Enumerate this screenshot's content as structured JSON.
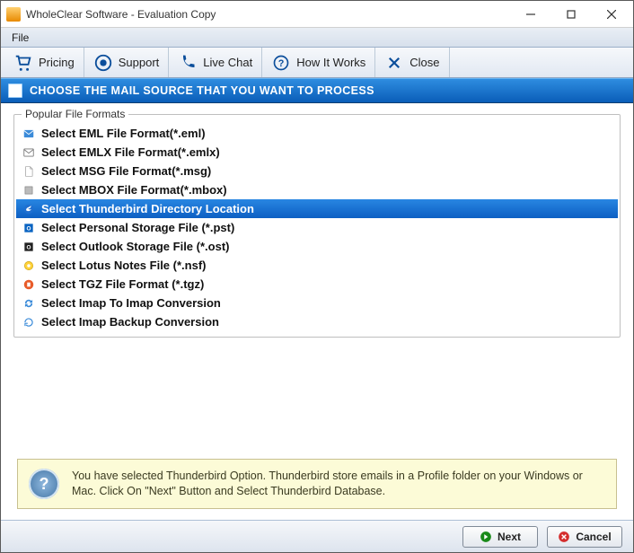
{
  "window": {
    "title": "WholeClear Software - Evaluation Copy"
  },
  "menubar": {
    "file": "File"
  },
  "toolbar": {
    "pricing": "Pricing",
    "support": "Support",
    "livechat": "Live Chat",
    "howitworks": "How It Works",
    "close": "Close"
  },
  "header": {
    "text": "CHOOSE THE MAIL SOURCE THAT YOU WANT TO PROCESS"
  },
  "group": {
    "legend": "Popular File Formats",
    "items": [
      {
        "icon": "mail-blue",
        "label": "Select EML File Format(*.eml)"
      },
      {
        "icon": "mail-gray",
        "label": "Select EMLX File Format(*.emlx)"
      },
      {
        "icon": "doc",
        "label": "Select MSG File Format(*.msg)"
      },
      {
        "icon": "box-grey",
        "label": "Select MBOX File Format(*.mbox)"
      },
      {
        "icon": "thunderbird",
        "label": "Select Thunderbird Directory Location",
        "selected": true
      },
      {
        "icon": "outlook-blue",
        "label": "Select Personal Storage File (*.pst)"
      },
      {
        "icon": "outlook-black",
        "label": "Select Outlook Storage File (*.ost)"
      },
      {
        "icon": "lotus",
        "label": "Select Lotus Notes File (*.nsf)"
      },
      {
        "icon": "tgz",
        "label": "Select TGZ File Format (*.tgz)"
      },
      {
        "icon": "sync",
        "label": "Select Imap To Imap Conversion"
      },
      {
        "icon": "backup",
        "label": "Select Imap Backup Conversion"
      }
    ]
  },
  "info": {
    "text": "You have selected Thunderbird Option. Thunderbird store emails in a Profile folder on your Windows or Mac. Click On \"Next\" Button and Select Thunderbird Database."
  },
  "footer": {
    "next": "Next",
    "cancel": "Cancel"
  }
}
